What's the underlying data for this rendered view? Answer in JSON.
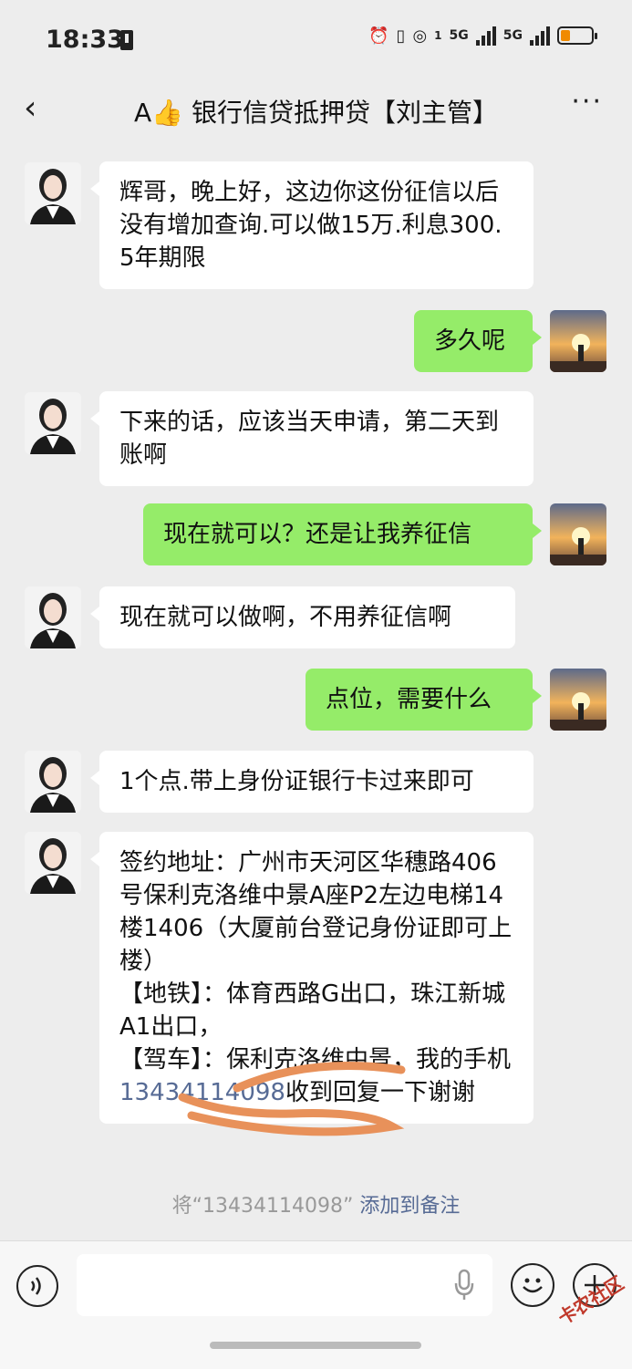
{
  "status_bar": {
    "time": "18:33",
    "network_1": "5G",
    "network_2": "5G",
    "sim_1": "1"
  },
  "header": {
    "title": "A👍 银行信贷抵押贷【刘主管】"
  },
  "messages": [
    {
      "side": "left",
      "text": "辉哥，晚上好，这边你这份征信以后没有增加查询.可以做15万.利息300.5年期限"
    },
    {
      "side": "right",
      "text": "多久呢"
    },
    {
      "side": "left",
      "text": "下来的话，应该当天申请，第二天到账啊"
    },
    {
      "side": "right",
      "text": "现在就可以？还是让我养征信"
    },
    {
      "side": "left",
      "text": "现在就可以做啊，不用养征信啊"
    },
    {
      "side": "right",
      "text": "点位，需要什么"
    },
    {
      "side": "left",
      "text": "1个点.带上身份证银行卡过来即可"
    },
    {
      "side": "left",
      "lines": [
        "签约地址：广州市天河区华穗路406号保利克洛维中景A座P2左边电梯14楼1406（大厦前台登记身份证即可上楼）",
        "【地铁】：体育西路G出口，珠江新城A1出口，",
        "【驾车】：保利克洛维中景，我的手机"
      ],
      "phone": "13434114098",
      "tail": "收到回复一下谢谢"
    }
  ],
  "system_note": {
    "prefix": "将“13434114098”",
    "link": "添加到备注"
  },
  "watermark": "卡农社区",
  "colors": {
    "bubble_right": "#95ec69",
    "bubble_left": "#ffffff",
    "link": "#576b95",
    "background": "#ededed"
  }
}
